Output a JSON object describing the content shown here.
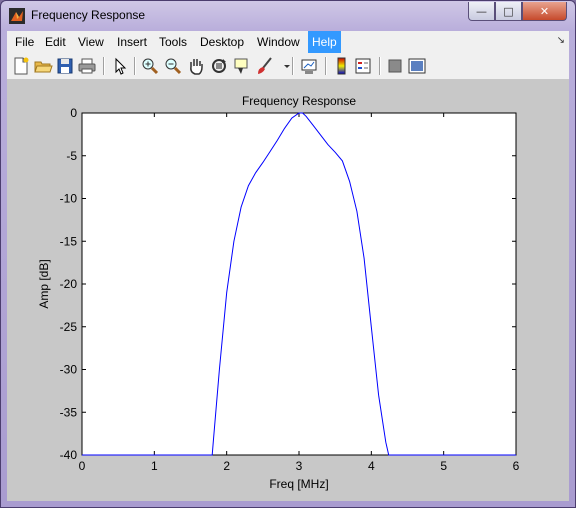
{
  "window": {
    "title": "Frequency Response"
  },
  "menu": {
    "items": [
      "File",
      "Edit",
      "View",
      "Insert",
      "Tools",
      "Desktop",
      "Window",
      "Help"
    ],
    "active": "Help"
  },
  "toolbar": {
    "icons": [
      "new-figure-icon",
      "open-file-icon",
      "save-icon",
      "print-icon",
      "pointer-icon",
      "zoom-in-icon",
      "zoom-out-icon",
      "pan-hand-icon",
      "rotate-3d-icon",
      "data-cursor-icon",
      "brush-icon",
      "colorbar-icon",
      "legend-icon",
      "hide-plot-tools-icon",
      "show-plot-tools-icon"
    ]
  },
  "colors": {
    "line": "#0000ff",
    "menu_active": "#3399ff",
    "figure_bg": "#c8c8c8"
  },
  "chart_data": {
    "type": "line",
    "title": "Frequency Response",
    "xlabel": "Freq [MHz]",
    "ylabel": "Amp [dB]",
    "xlim": [
      0,
      6
    ],
    "ylim": [
      -40,
      0
    ],
    "xticks": [
      0,
      1,
      2,
      3,
      4,
      5,
      6
    ],
    "yticks": [
      0,
      -5,
      -10,
      -15,
      -20,
      -25,
      -30,
      -35,
      -40
    ],
    "grid": false,
    "series": [
      {
        "x": [
          0,
          1.8,
          1.82,
          1.9,
          2.0,
          2.1,
          2.2,
          2.3,
          2.4,
          2.5,
          2.6,
          2.7,
          2.8,
          2.9,
          3.0,
          3.05,
          3.1,
          3.2,
          3.3,
          3.4,
          3.5,
          3.6,
          3.7,
          3.8,
          3.9,
          4.0,
          4.1,
          4.2,
          4.24,
          6
        ],
        "y": [
          -40,
          -40,
          -38,
          -30,
          -21,
          -15,
          -11,
          -8.5,
          -7,
          -5.8,
          -4.5,
          -3.2,
          -1.8,
          -0.6,
          0,
          0,
          -0.4,
          -1.5,
          -2.6,
          -3.7,
          -4.6,
          -5.6,
          -8,
          -11.5,
          -17,
          -25,
          -33,
          -38.5,
          -40,
          -40
        ]
      }
    ]
  }
}
